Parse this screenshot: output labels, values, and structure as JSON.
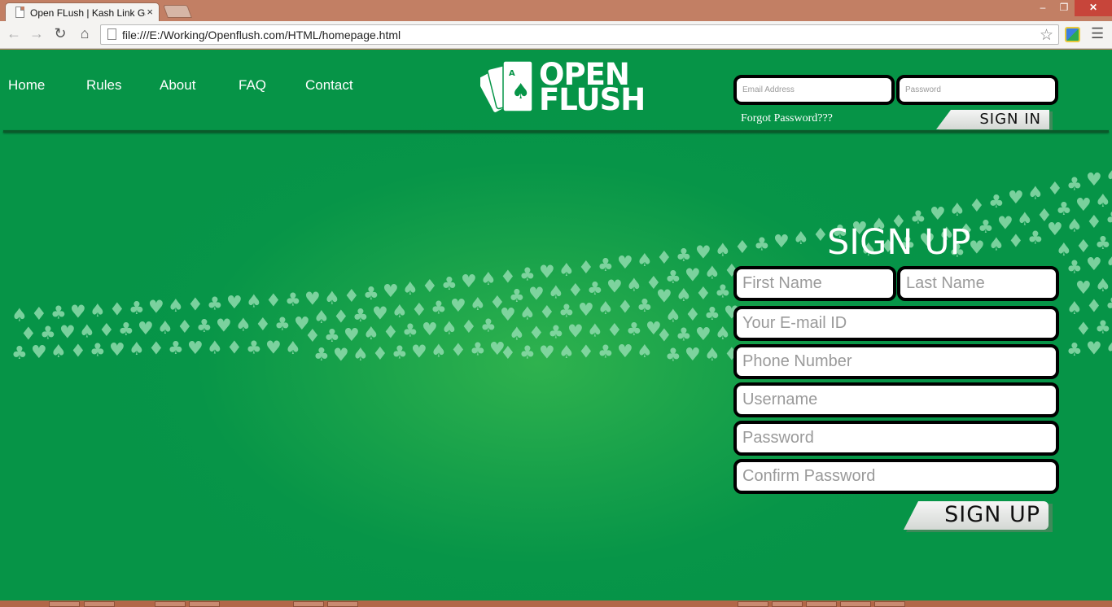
{
  "browser": {
    "tab_title": "Open FLush | Kash Link Games",
    "tab_close": "×",
    "url": "file:///E:/Working/Openflush.com/HTML/homepage.html",
    "window_buttons": {
      "minimize": "–",
      "restore": "❐",
      "close": "✕"
    }
  },
  "nav": [
    "Home",
    "Rules",
    "About",
    "FAQ",
    "Contact"
  ],
  "logo": {
    "line1": "OPEN",
    "line2": "FLUSH"
  },
  "signin": {
    "email_placeholder": "Email Address",
    "password_placeholder": "Password",
    "forgot": "Forgot Password???",
    "button": "SIGN IN"
  },
  "signup": {
    "title": "SIGN UP",
    "first_name": "First Name",
    "last_name": "Last Name",
    "email": "Your E-mail ID",
    "phone": "Phone Number",
    "username": "Username",
    "password": "Password",
    "confirm": "Confirm Password",
    "button": "SIGN UP"
  },
  "colors": {
    "page_green": "#079548",
    "accent_light": "#8fdcad",
    "button_bg": "#e8ebe8"
  }
}
